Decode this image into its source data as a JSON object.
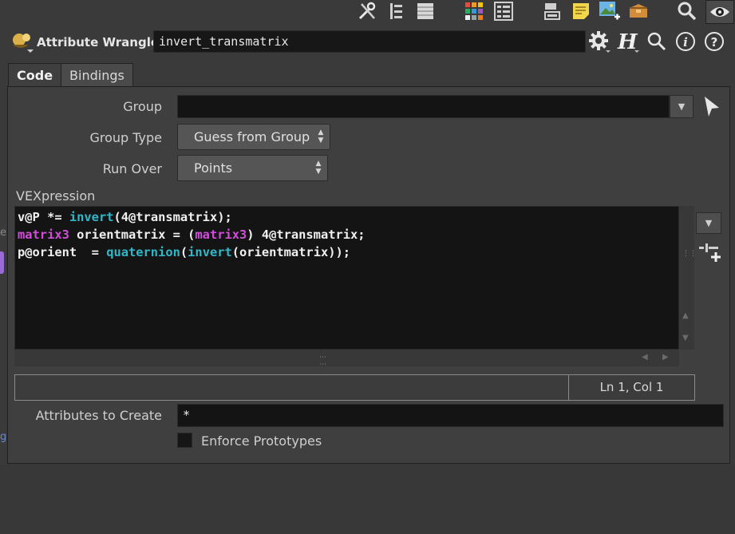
{
  "toolbar": {
    "icons": [
      "wrench-icon",
      "tree-icon",
      "list-icon",
      "color-grid-icon",
      "spreadsheet-icon",
      "network-icon",
      "sticky-note-icon",
      "image-add-icon",
      "package-icon",
      "search-icon",
      "eye-icon"
    ]
  },
  "node": {
    "type_label": "Attribute Wrangle",
    "name": "invert_transmatrix",
    "header_icons": [
      "gear-icon",
      "houdini-help-icon",
      "search-icon",
      "info-icon",
      "question-icon"
    ]
  },
  "tabs": [
    {
      "label": "Code",
      "active": true
    },
    {
      "label": "Bindings",
      "active": false
    }
  ],
  "params": {
    "group_label": "Group",
    "group_value": "",
    "group_type_label": "Group Type",
    "group_type_value": "Guess from Group",
    "run_over_label": "Run Over",
    "run_over_value": "Points",
    "vexpression_label": "VEXpression",
    "attributes_label": "Attributes to Create",
    "attributes_value": "*",
    "enforce_label": "Enforce Prototypes",
    "enforce_checked": false
  },
  "code": {
    "line1": {
      "a": "v@P *= ",
      "f1": "invert",
      "b": "(4@transmatrix);"
    },
    "line2": {
      "k1": "matrix3",
      "a": " orientmatrix = (",
      "k2": "matrix3",
      "b": ") 4@transmatrix;"
    },
    "line3": {
      "a": "p@orient  = ",
      "f1": "quaternion",
      "b": "(",
      "f2": "invert",
      "c": "(orientmatrix));"
    }
  },
  "status": {
    "position": "Ln 1, Col 1"
  },
  "colors": {
    "keyword": "#d24ddb",
    "function": "#30b8c8",
    "field_bg": "#141414",
    "panel_bg": "#3f3f3f"
  }
}
